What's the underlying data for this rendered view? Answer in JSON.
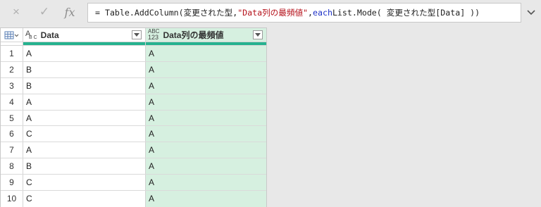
{
  "formula_bar": {
    "cancel_icon": "×",
    "commit_icon": "✓",
    "fx_label": "fx",
    "formula_prefix": "= Table.AddColumn(変更された型, ",
    "formula_string": "\"Data列の最頻値\"",
    "formula_sep": ", ",
    "formula_keyword": "each",
    "formula_suffix": " List.Mode( 変更された型[Data] ))"
  },
  "grid": {
    "columns": [
      {
        "name": "Data",
        "type_top": "A",
        "type_bottom": "B C",
        "type": "text"
      },
      {
        "name": "Data列の最頻値",
        "type_top": "ABC",
        "type_bottom": "123",
        "type": "any"
      }
    ],
    "rows": [
      {
        "num": "1",
        "data": "A",
        "mode": "A"
      },
      {
        "num": "2",
        "data": "B",
        "mode": "A"
      },
      {
        "num": "3",
        "data": "B",
        "mode": "A"
      },
      {
        "num": "4",
        "data": "A",
        "mode": "A"
      },
      {
        "num": "5",
        "data": "A",
        "mode": "A"
      },
      {
        "num": "6",
        "data": "C",
        "mode": "A"
      },
      {
        "num": "7",
        "data": "A",
        "mode": "A"
      },
      {
        "num": "8",
        "data": "B",
        "mode": "A"
      },
      {
        "num": "9",
        "data": "C",
        "mode": "A"
      },
      {
        "num": "10",
        "data": "C",
        "mode": "A"
      }
    ]
  },
  "colors": {
    "selected_column_bg": "#d6f0e0",
    "quality_bar": "#25b28f",
    "string_literal": "#b5121b",
    "keyword": "#1e32c8"
  }
}
